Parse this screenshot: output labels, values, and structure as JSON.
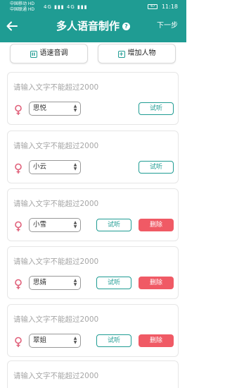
{
  "status_bar": {
    "carrier_1": "中国移动 HD",
    "carrier_2": "中国联通 HD",
    "signal_text": "4G ▮▮▮ 4G ▮▮▮",
    "battery": "67",
    "time": "11:18"
  },
  "header": {
    "title": "多人语音制作",
    "help_icon": "?",
    "next_label": "下一步"
  },
  "actions": {
    "speed_label": "语速音调",
    "add_person_label": "增加人物"
  },
  "cards": [
    {
      "placeholder": "请输入文字不能超过2000",
      "voice": "思悦",
      "listen": "试听",
      "delete": null
    },
    {
      "placeholder": "请输入文字不能超过2000",
      "voice": "小云",
      "listen": "试听",
      "delete": null
    },
    {
      "placeholder": "请输入文字不能超过2000",
      "voice": "小雪",
      "listen": "试听",
      "delete": "删除"
    },
    {
      "placeholder": "请输入文字不能超过2000",
      "voice": "思婧",
      "listen": "试听",
      "delete": "删除"
    },
    {
      "placeholder": "请输入文字不能超过2000",
      "voice": "翠姐",
      "listen": "试听",
      "delete": "删除"
    },
    {
      "placeholder": "请输入文字不能超过2000"
    }
  ],
  "colors": {
    "accent": "#1f9c93",
    "delete": "#f05a65",
    "female_icon": "#e0607a"
  }
}
